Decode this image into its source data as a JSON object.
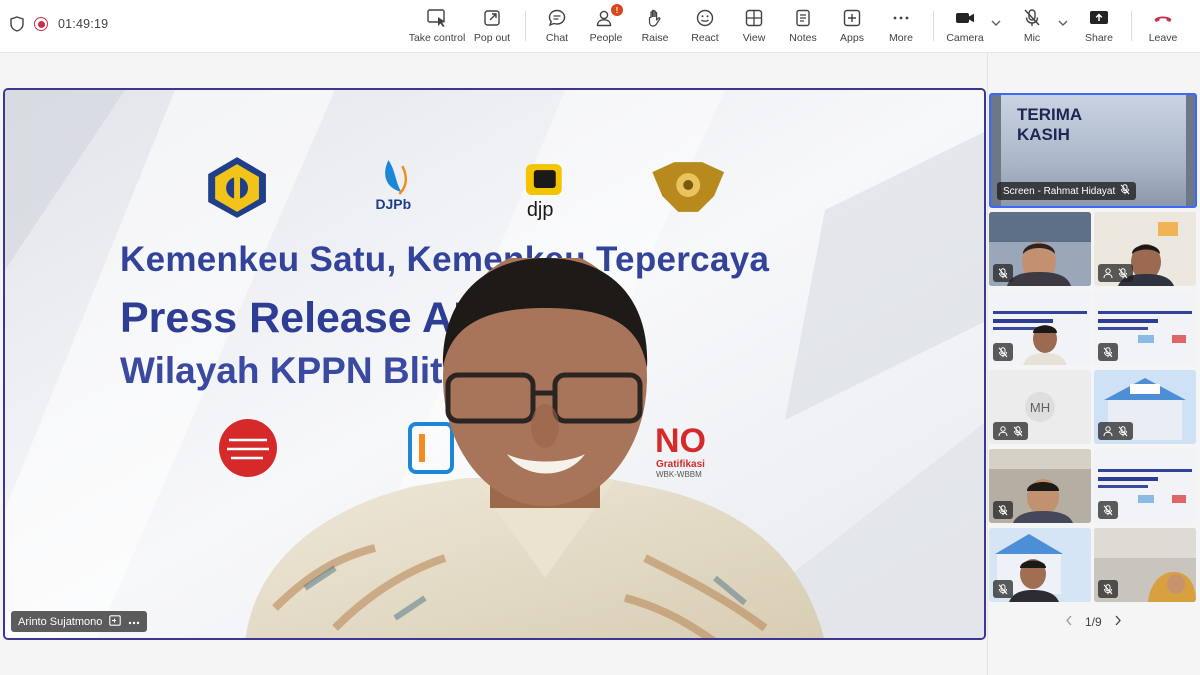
{
  "meeting": {
    "timer": "01:49:19"
  },
  "toolbar": {
    "buttons": [
      {
        "label": "Take control",
        "icon": "take-control-icon"
      },
      {
        "label": "Pop out",
        "icon": "pop-out-icon"
      },
      {
        "label": "Chat",
        "icon": "chat-icon"
      },
      {
        "label": "People",
        "icon": "people-icon",
        "badge": "!"
      },
      {
        "label": "Raise",
        "icon": "raise-hand-icon"
      },
      {
        "label": "React",
        "icon": "react-icon"
      },
      {
        "label": "View",
        "icon": "view-icon"
      },
      {
        "label": "Notes",
        "icon": "notes-icon"
      },
      {
        "label": "Apps",
        "icon": "apps-icon"
      },
      {
        "label": "More",
        "icon": "more-icon"
      },
      {
        "label": "Camera",
        "icon": "camera-icon"
      },
      {
        "label": "Mic",
        "icon": "mic-icon"
      },
      {
        "label": "Share",
        "icon": "share-icon"
      },
      {
        "label": "Leave",
        "icon": "leave-icon"
      }
    ]
  },
  "stage": {
    "slide": {
      "logo_djpb": "DJPb",
      "logo_djp": "djp",
      "line1": "Kemenkeu Satu, Kemenkeu Tepercaya",
      "line2": "Press Release APBN",
      "line3": "Wilayah KPPN Blitar",
      "no_label": "NO",
      "gratifikasi": "Gratifikasi",
      "wbk": "WBK-WBBM"
    },
    "speaker_name": "Arinto Sujatmono"
  },
  "sidebar": {
    "screen_share": {
      "slide_text_1": "TERIMA",
      "slide_text_2": "KASIH",
      "label": "Screen - Rahmat Hidayat"
    },
    "participant_initials": "MH",
    "pager": "1/9"
  },
  "colors": {
    "accent": "#3d3592",
    "leave": "#c4314b",
    "slide_title": "#2e3d94"
  }
}
